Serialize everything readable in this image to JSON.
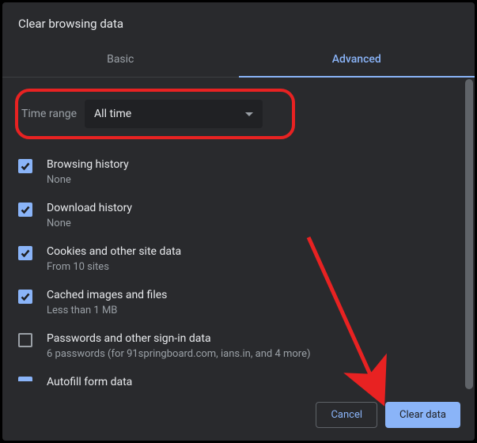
{
  "title": "Clear browsing data",
  "tabs": {
    "basic": "Basic",
    "advanced": "Advanced"
  },
  "timeRange": {
    "label": "Time range",
    "value": "All time"
  },
  "options": [
    {
      "title": "Browsing history",
      "sub": "None",
      "checked": true
    },
    {
      "title": "Download history",
      "sub": "None",
      "checked": true
    },
    {
      "title": "Cookies and other site data",
      "sub": "From 10 sites",
      "checked": true
    },
    {
      "title": "Cached images and files",
      "sub": "Less than 1 MB",
      "checked": true
    },
    {
      "title": "Passwords and other sign-in data",
      "sub": "6 passwords (for 91springboard.com, ians.in, and 4 more)",
      "checked": false
    }
  ],
  "partialOption": {
    "title": "Autofill form data"
  },
  "buttons": {
    "cancel": "Cancel",
    "clear": "Clear data"
  }
}
